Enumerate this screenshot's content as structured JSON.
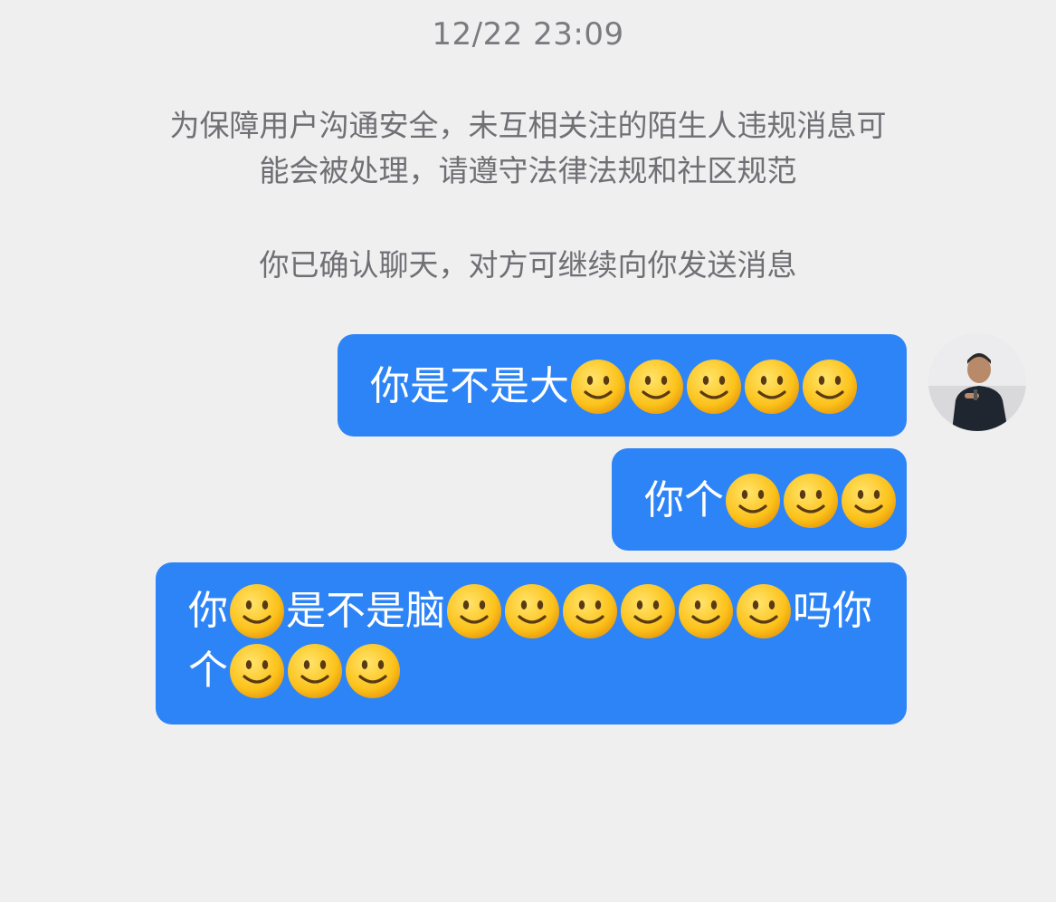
{
  "chat": {
    "timestamp": "12/22 23:09",
    "notice_lines": [
      "为保障用户沟通安全，未互相关注的陌生人违规消息可",
      "能会被处理，请遵守法律法规和社区规范"
    ],
    "confirm_text": "你已确认聊天，对方可继续向你发送消息"
  },
  "messages": [
    {
      "sender": "self",
      "lines": [
        {
          "text": "你是不是大",
          "emoji_count": 5,
          "emoji_icon": "slightly-smiling-face-icon"
        }
      ]
    },
    {
      "sender": "self",
      "lines": [
        {
          "text": "你个",
          "emoji_count": 3,
          "emoji_icon": "slightly-smiling-face-icon"
        }
      ]
    },
    {
      "sender": "self",
      "lines": [
        {
          "segments": [
            "你",
            "是不是脑",
            "吗你"
          ]
        },
        {
          "segments": [
            "个"
          ]
        }
      ]
    }
  ],
  "avatar": {
    "icon": "user-avatar-photo"
  },
  "colors": {
    "background": "#efeff0",
    "bubble": "#2d84f7",
    "bubble_text": "#ffffff",
    "meta_text": "#7a7a7f"
  }
}
